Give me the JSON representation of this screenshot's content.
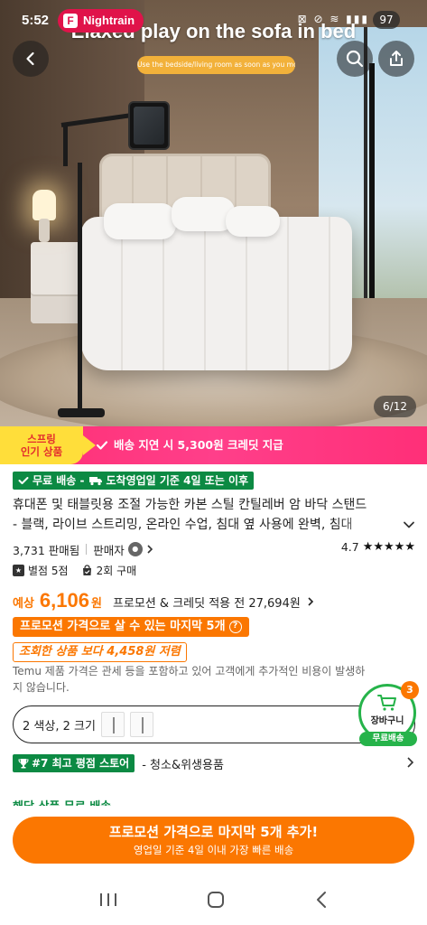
{
  "status_bar": {
    "time": "5:52",
    "app_pill": "Nightrain",
    "app_logo": "F",
    "icons": "⊠ ⊘ ≋ ▮▮▮",
    "battery": "97"
  },
  "hero": {
    "headline": "Elaxed play on the sofa in bed",
    "sub_caption": "Use the bedside/living room as soon as you move it",
    "counter": "6/12"
  },
  "promo": {
    "badge_line1": "스프링",
    "badge_line2": "인기 상품",
    "strip_text": "배송 지연 시 5,300원 크레딧 지급"
  },
  "shipping_badge": "무료 배송 - ",
  "shipping_badge_2": "도착영업일 기준 4일 또는 이후",
  "product": {
    "title_line1": "휴대폰 및 태블릿용 조절 가능한 카본 스틸 칸틸레버 암 바닥 스탠드",
    "title_line2": "- 블랙, 라이브 스트리밍, 온라인 수업, 침대 옆 사용에 완벽, 침대"
  },
  "stats": {
    "sold": "3,731 판매됨",
    "seller_label": "판매자",
    "rating": "4.7",
    "stars": "★★★★★"
  },
  "meta": {
    "reviews": "별점 5점",
    "repurchase": "2회 구매"
  },
  "price": {
    "prefix": "예상",
    "amount": "6,106",
    "won": "원",
    "original": "프로모션 & 크레딧 적용 전 27,694원"
  },
  "last_units": "프로모션 가격으로 살 수 있는 마지막 5개",
  "cheaper_badge": "조회한 상품 보다 4,458원 저렴",
  "disclaimer": "Temu 제품 가격은 관세 등을 포함하고 있어 고객에게 추가적인 비용이 발생하지 않습니다.",
  "variant": {
    "label": "2 색상, 2 크기"
  },
  "cart": {
    "label": "장바구니",
    "free": "무료배송",
    "count": "3"
  },
  "store": {
    "badge": "#7 최고 평점 스토어",
    "category": "- 청소&위생용품"
  },
  "peek_text": "해당 상품 무료 배송",
  "cta": {
    "main": "프로모션 가격으로 마지막 5개 추가!",
    "sub": "영업일 기준 4일 이내 가장 빠른 배송"
  },
  "colors": {
    "accent_orange": "#fb7701",
    "green": "#0c8a43",
    "promo_pink": "#ff2e73",
    "badge_yellow": "#ffde3a"
  }
}
